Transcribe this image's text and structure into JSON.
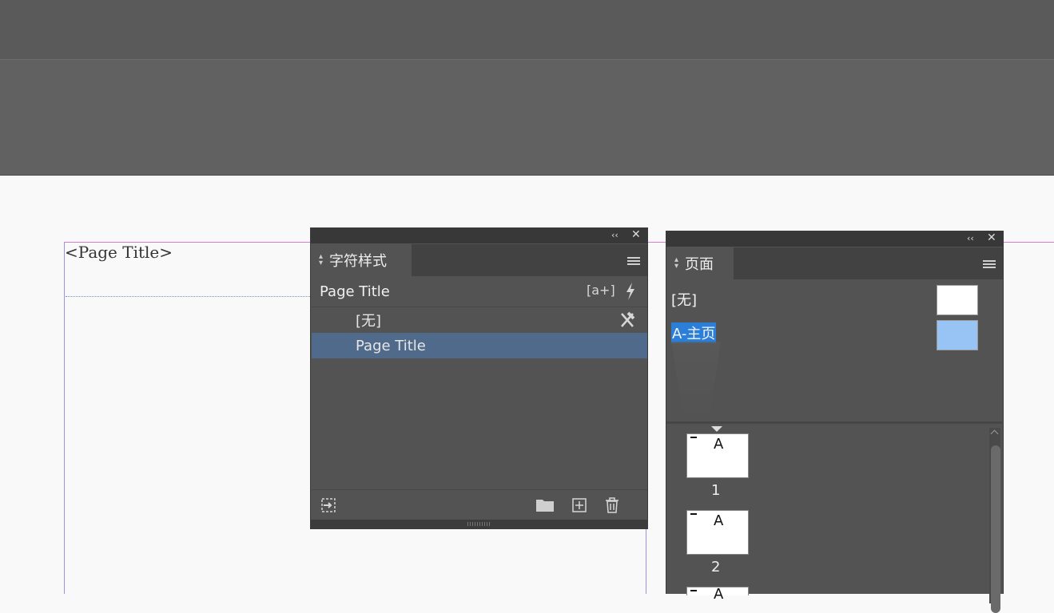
{
  "document": {
    "page_title_text": "<Page Title>"
  },
  "character_styles_panel": {
    "tab_label": "字符样式",
    "current_style": "Page Title",
    "styles": [
      {
        "label": "[无]"
      },
      {
        "label": "Page Title",
        "selected": true
      }
    ],
    "header_icons": [
      "new-style-from-selection-icon",
      "lightning-icon"
    ],
    "footer_icons": [
      "import-styles-icon",
      "folder-icon",
      "new-style-icon",
      "trash-icon"
    ]
  },
  "pages_panel": {
    "tab_label": "页面",
    "masters": [
      {
        "label": "[无]"
      },
      {
        "label": "A-主页",
        "selected": true
      }
    ],
    "pages": [
      {
        "number": "1",
        "master_prefix": "A"
      },
      {
        "number": "2",
        "master_prefix": "A"
      },
      {
        "number": "",
        "master_prefix": "A"
      }
    ]
  },
  "colors": {
    "selection_blue": "#4f6a8b",
    "master_selected_bg": "#2b7fd9",
    "master_thumb_blue": "#97c4f5"
  },
  "glyphs": {
    "collapse": "‹‹",
    "close": "✕"
  }
}
